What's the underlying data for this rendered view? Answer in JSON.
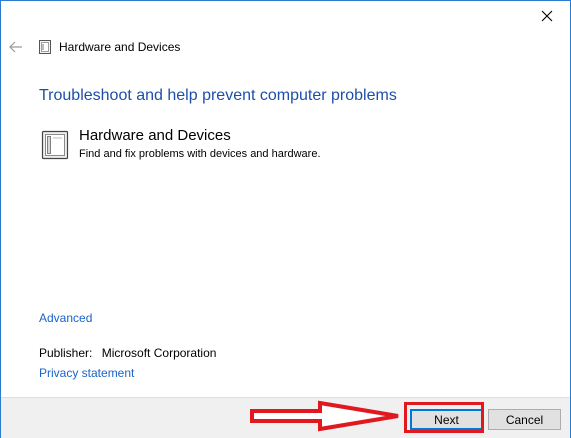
{
  "window": {
    "close_label": "×",
    "border_color": "#2b7bd1"
  },
  "nav": {
    "back_icon": "back-arrow-icon",
    "page_icon": "hardware-device-icon",
    "title": "Hardware and Devices"
  },
  "main": {
    "heading": "Troubleshoot and help prevent computer problems",
    "heading_color": "#1e4fa8",
    "item": {
      "icon": "hardware-device-icon",
      "title": "Hardware and Devices",
      "description": "Find and fix problems with devices and hardware."
    },
    "advanced_link": "Advanced",
    "publisher_label": "Publisher:",
    "publisher_value": "Microsoft Corporation",
    "privacy_link": "Privacy statement",
    "link_color": "#1a64c8"
  },
  "footer": {
    "next_label": "Next",
    "cancel_label": "Cancel"
  },
  "annotation": {
    "color": "#e1191e",
    "shapes": [
      "arrow-right",
      "highlight-box"
    ]
  }
}
